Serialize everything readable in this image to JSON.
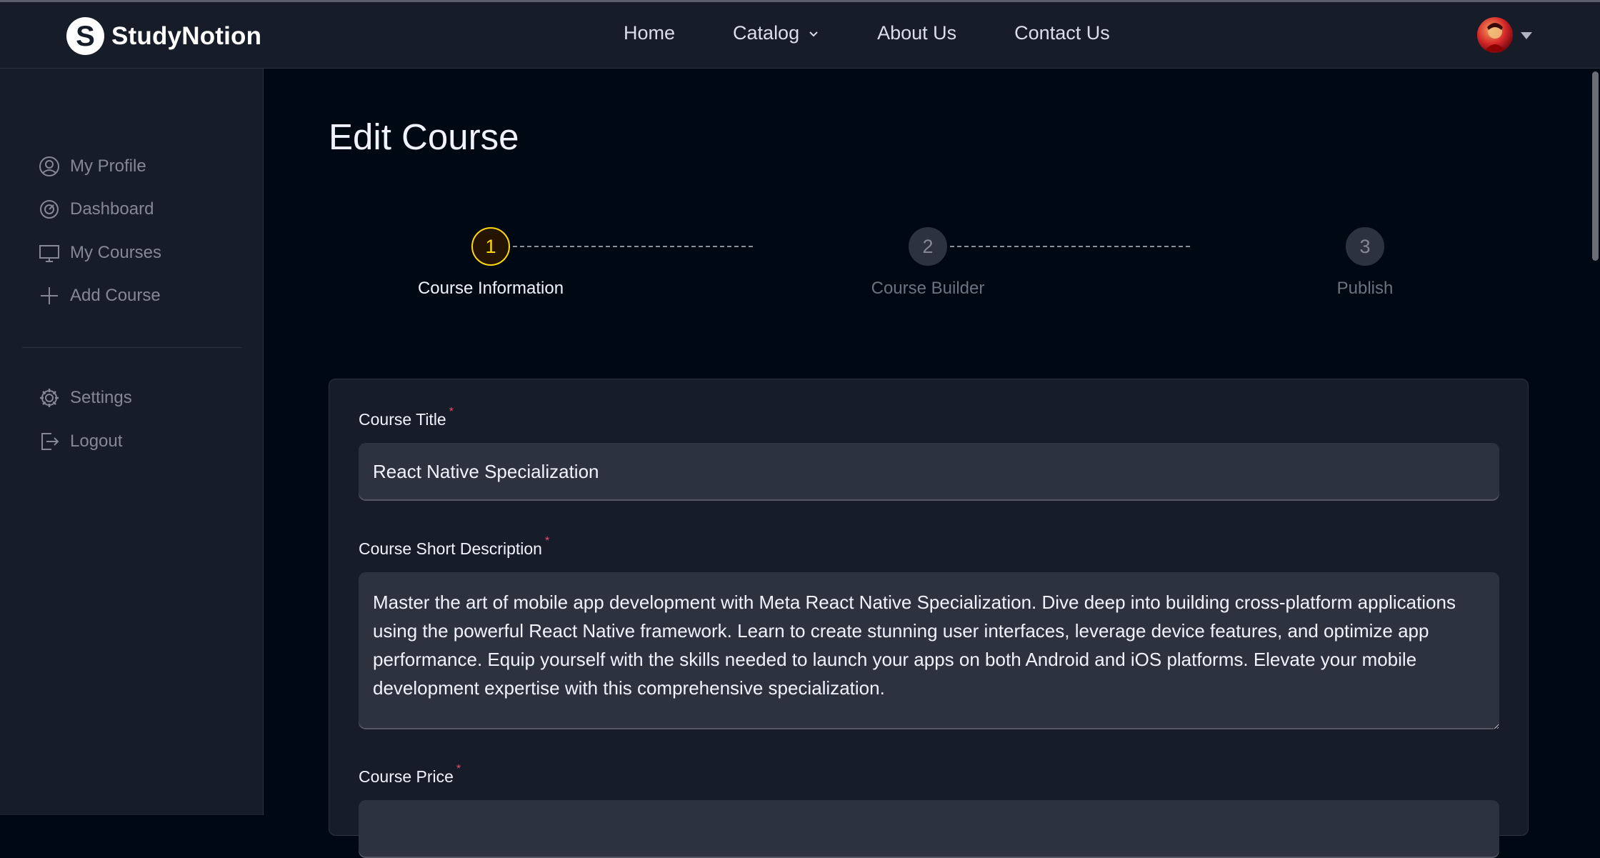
{
  "brand": {
    "name": "StudyNotion",
    "mark": "S"
  },
  "nav": {
    "links": [
      "Home",
      "Catalog",
      "About Us",
      "Contact Us"
    ]
  },
  "sidebar": {
    "items": [
      {
        "label": "My Profile",
        "icon": "user-circle-icon"
      },
      {
        "label": "Dashboard",
        "icon": "gauge-icon"
      },
      {
        "label": "My Courses",
        "icon": "monitor-icon"
      },
      {
        "label": "Add Course",
        "icon": "plus-icon"
      }
    ],
    "bottom_items": [
      {
        "label": "Settings",
        "icon": "gear-icon"
      },
      {
        "label": "Logout",
        "icon": "logout-icon"
      }
    ]
  },
  "page": {
    "title": "Edit Course"
  },
  "steps": [
    {
      "number": "1",
      "label": "Course Information",
      "state": "active"
    },
    {
      "number": "2",
      "label": "Course Builder",
      "state": "idle"
    },
    {
      "number": "3",
      "label": "Publish",
      "state": "idle"
    }
  ],
  "form": {
    "title_label": "Course Title",
    "title_value": "React Native Specialization",
    "desc_label": "Course Short Description",
    "desc_value": "Master the art of mobile app development with Meta React Native Specialization. Dive deep into building cross-platform applications using the powerful React Native framework. Learn to create stunning user interfaces, leverage device features, and optimize app performance. Equip yourself with the skills needed to launch your apps on both Android and iOS platforms. Elevate your mobile development expertise with this comprehensive specialization.",
    "price_label": "Course Price",
    "required_mark": "*"
  },
  "colors": {
    "background": "#000814",
    "panel": "#161D29",
    "input": "#2C333F",
    "accent": "#FFD60A",
    "required": "#EF476F"
  }
}
